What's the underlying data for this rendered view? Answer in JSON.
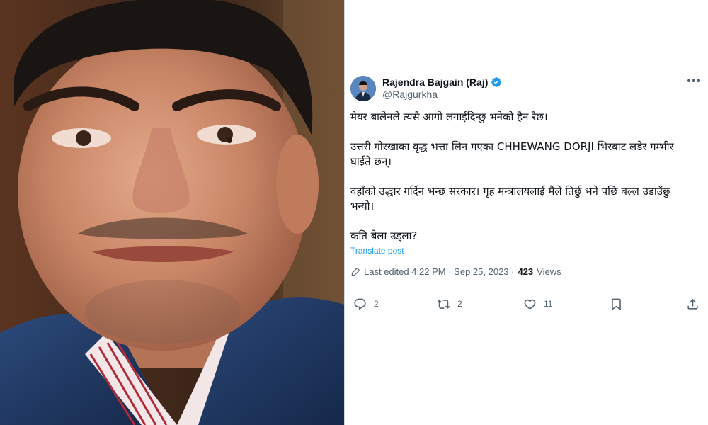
{
  "photo": {
    "alt_description": ""
  },
  "tweet": {
    "author": {
      "display_name": "Rajendra Bajgain (Raj)",
      "handle": "@Rajgurkha",
      "verified_color": "#1d9bf0"
    },
    "more_label": "•••",
    "paragraphs": [
      "मेयर बालेनले त्यसै आगो लगाईदिन्छु भनेको हैन रैछ।",
      "उत्तरी गोरखाका वृद्ध भत्ता लिन गएका CHHEWANG DORJI भिरबाट लडेर गम्भीर घाईते छन्।",
      "वहाँको उद्धार गर्दिन भन्छ सरकार। गृह मन्त्रालयलाई मैले तिर्छु भने पछि बल्ल उडाउँछु भन्यो।",
      "कति बेला उड्ला?"
    ],
    "translate_label": "Translate post",
    "meta": {
      "edited_label": "Last edited 4:22 PM · Sep 25, 2023 ·",
      "views_count": "423",
      "views_label": "Views"
    },
    "actions": {
      "reply_count": "2",
      "repost_count": "2",
      "like_count": "11"
    },
    "accent_color": "#1d9bf0"
  }
}
